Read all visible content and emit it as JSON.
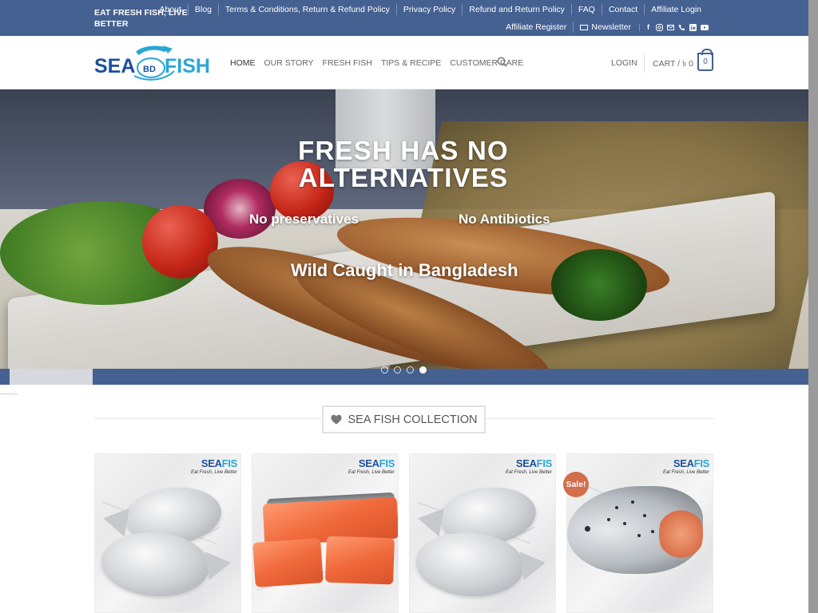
{
  "topbar": {
    "tagline": "EAT FRESH FISH, LIVE BETTER",
    "links": [
      "About",
      "Blog",
      "Terms & Conditions, Return & Refund Policy",
      "Privacy Policy",
      "Refund and Return Policy",
      "FAQ",
      "Contact",
      "Affiliate Login"
    ],
    "affiliate_register": "Affiliate Register",
    "newsletter": "Newsletter",
    "social_icons": [
      "facebook-icon",
      "instagram-icon",
      "email-icon",
      "phone-icon",
      "linkedin-icon",
      "youtube-icon"
    ]
  },
  "header": {
    "logo_text_left": "SEA",
    "logo_text_mid": "BD",
    "logo_text_right": "FISH",
    "nav": [
      "HOME",
      "OUR STORY",
      "FRESH FISH",
      "TIPS & RECIPE",
      "CUSTOMER CARE"
    ],
    "login": "LOGIN",
    "cart_label": "CART / ৳ 0",
    "cart_count": "0"
  },
  "hero": {
    "headline": "FRESH HAS NO ALTERNATIVES",
    "point1": "No preservatives",
    "point2": "No Antibiotics",
    "point3": "Wild Caught in Bangladesh",
    "slide_count": 4,
    "active_slide": 4
  },
  "section": {
    "title": "SEA FISH COLLECTION"
  },
  "products": [
    {
      "brand": "SEA",
      "brand_tail": "FIS",
      "tagline": "Eat Fresh, Live Better",
      "sale": false
    },
    {
      "brand": "SEA",
      "brand_tail": "FIS",
      "tagline": "Eat Fresh, Live Better",
      "sale": false
    },
    {
      "brand": "SEA",
      "brand_tail": "FIS",
      "tagline": "Eat Fresh, Live Better",
      "sale": false
    },
    {
      "brand": "SEA",
      "brand_tail": "FIS",
      "tagline": "Eat Fresh, Live Better",
      "sale": true,
      "sale_label": "Sale!"
    }
  ],
  "colors": {
    "primary": "#456191",
    "sale_badge": "#d26e4b",
    "logo_blue": "#1d4f9c",
    "logo_cyan": "#28a6d8"
  }
}
